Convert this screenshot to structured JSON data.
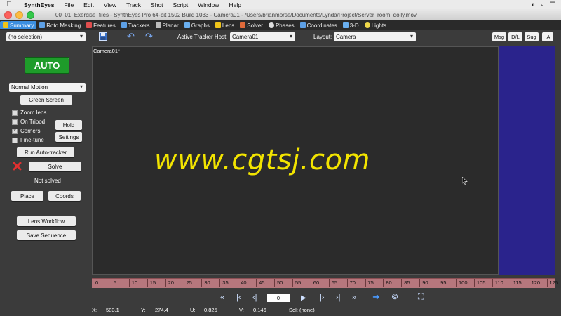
{
  "menubar": {
    "app_name": "SynthEyes",
    "items": [
      "File",
      "Edit",
      "View",
      "Track",
      "Shot",
      "Script",
      "Window",
      "Help"
    ]
  },
  "window": {
    "title": "00_01_Exercise_files - SynthEyes Pro 64-bit 1502 Build 1033 - Camera01 - /Users/brianmorse/Documents/Lynda/Project/Server_room_dolly.mov"
  },
  "room_tabs": [
    {
      "label": "Summary",
      "active": true,
      "color": "#f0c419"
    },
    {
      "label": "Roto Masking",
      "active": false,
      "color": "#5da0e6"
    },
    {
      "label": "Features",
      "active": false,
      "color": "#e04e4e"
    },
    {
      "label": "Trackers",
      "active": false,
      "color": "#5da0e6"
    },
    {
      "label": "Planar",
      "active": false,
      "color": "#bbbbbb"
    },
    {
      "label": "Graphs",
      "active": false,
      "color": "#6ab0f0"
    },
    {
      "label": "Lens",
      "active": false,
      "color": "#f0c419"
    },
    {
      "label": "Solver",
      "active": false,
      "color": "#e06a3a"
    },
    {
      "label": "Phases",
      "active": false,
      "color": "#dddddd"
    },
    {
      "label": "Coordinates",
      "active": false,
      "color": "#5da0e6"
    },
    {
      "label": "3-D",
      "active": false,
      "color": "#6ab0f0"
    },
    {
      "label": "Lights",
      "active": false,
      "color": "#f0d84a"
    }
  ],
  "toolbar": {
    "selection_value": "(no selection)",
    "tracker_host_label": "Active Tracker Host:",
    "tracker_host_value": "Camera01",
    "layout_label": "Layout:",
    "layout_value": "Camera",
    "buttons": [
      "Msg",
      "D/L",
      "Sug",
      "IA"
    ]
  },
  "summary_panel": {
    "auto_label": "AUTO",
    "motion_value": "Normal Motion",
    "green_screen_label": "Green Screen",
    "zoom_lens_label": "Zoom lens",
    "on_tripod_label": "On Tripod",
    "hold_label": "Hold",
    "corners_label": "Corners",
    "settings_label": "Settings",
    "fine_tune_label": "Fine-tune",
    "run_auto_tracker_label": "Run Auto-tracker",
    "solve_label": "Solve",
    "status_text": "Not solved",
    "place_label": "Place",
    "coords_label": "Coords",
    "lens_workflow_label": "Lens Workflow",
    "save_sequence_label": "Save Sequence"
  },
  "viewport": {
    "camera_label": "Camera01*",
    "watermark": "www.cgtsj.com"
  },
  "timeline": {
    "ticks": [
      "0",
      "5",
      "10",
      "15",
      "20",
      "25",
      "30",
      "35",
      "40",
      "45",
      "50",
      "55",
      "60",
      "65",
      "70",
      "75",
      "80",
      "85",
      "90",
      "95",
      "100",
      "105",
      "110",
      "115",
      "120",
      "125"
    ]
  },
  "playback": {
    "frame_value": "0"
  },
  "statusbar": {
    "x_label": "X:",
    "x_value": "583.1",
    "y_label": "Y:",
    "y_value": "274.4",
    "u_label": "U:",
    "u_value": "0.825",
    "v_label": "V:",
    "v_value": "0.146",
    "sel_text": "Sel: (none)"
  }
}
